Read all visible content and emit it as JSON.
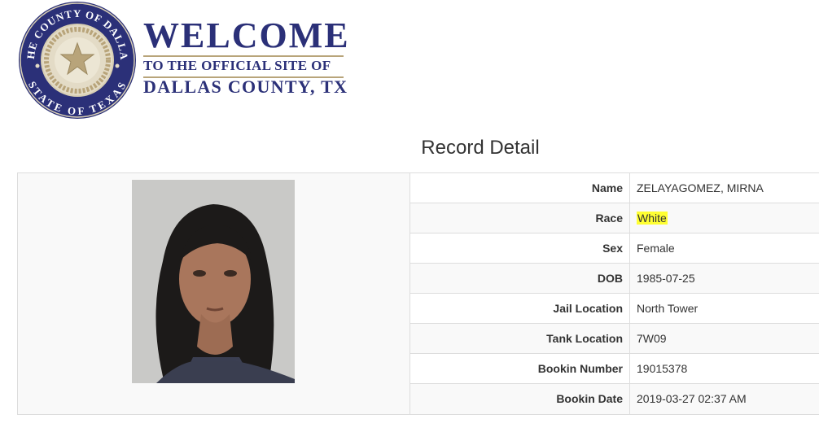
{
  "seal": {
    "top_text": "THE COUNTY OF DALLAS",
    "bottom_text": "STATE OF TEXAS",
    "colors": {
      "ring": "#2b3078",
      "inner": "#e3dbc6",
      "star": "#b8a47a"
    }
  },
  "banner": {
    "welcome": "WELCOME",
    "line2": "TO THE OFFICIAL SITE OF",
    "line3": "DALLAS COUNTY, TX"
  },
  "page_title": "Record Detail",
  "record": {
    "rows": [
      {
        "label": "Name",
        "value": "ZELAYAGOMEZ, MIRNA"
      },
      {
        "label": "Race",
        "value": "White",
        "highlighted": true
      },
      {
        "label": "Sex",
        "value": "Female"
      },
      {
        "label": "DOB",
        "value": "1985-07-25"
      },
      {
        "label": "Jail Location",
        "value": "North Tower"
      },
      {
        "label": "Tank Location",
        "value": "7W09"
      },
      {
        "label": "Bookin Number",
        "value": "19015378"
      },
      {
        "label": "Bookin Date",
        "value": "2019-03-27 02:37 AM"
      }
    ]
  },
  "colors": {
    "brand": "#2b3078",
    "gold": "#b8a47a",
    "highlight": "#ffff33"
  }
}
